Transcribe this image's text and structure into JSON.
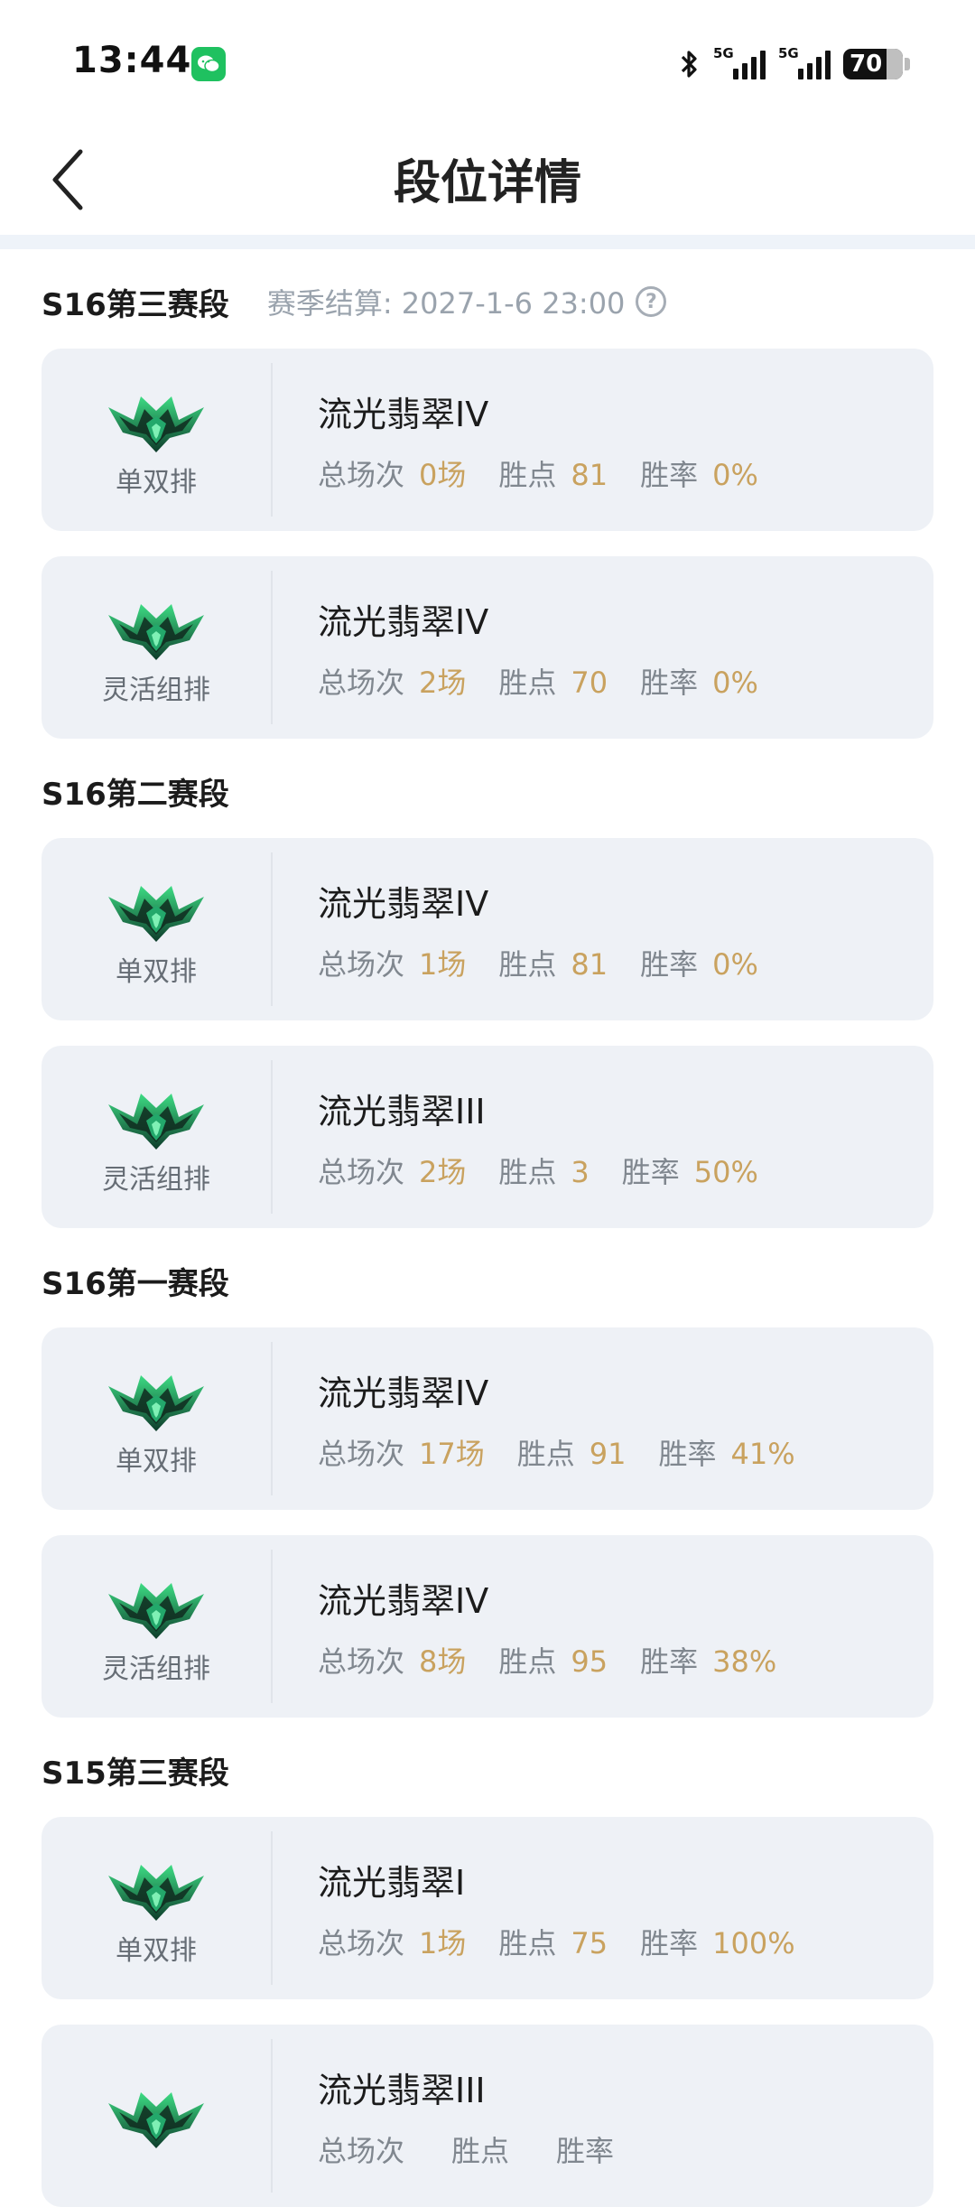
{
  "status_bar": {
    "time": "13:44",
    "signal_1_label": "5G",
    "signal_2_label": "5G",
    "battery": "70"
  },
  "header": {
    "title": "段位详情"
  },
  "labels": {
    "games": "总场次",
    "points": "胜点",
    "winrate": "胜率"
  },
  "sections": [
    {
      "title": "S16第三赛段",
      "settlement": "赛季结算: 2027-1-6 23:00",
      "cards": [
        {
          "queue": "单双排",
          "rank": "流光翡翠IV",
          "games": "0场",
          "points": "81",
          "winrate": "0%"
        },
        {
          "queue": "灵活组排",
          "rank": "流光翡翠IV",
          "games": "2场",
          "points": "70",
          "winrate": "0%"
        }
      ]
    },
    {
      "title": "S16第二赛段",
      "cards": [
        {
          "queue": "单双排",
          "rank": "流光翡翠IV",
          "games": "1场",
          "points": "81",
          "winrate": "0%"
        },
        {
          "queue": "灵活组排",
          "rank": "流光翡翠III",
          "games": "2场",
          "points": "3",
          "winrate": "50%"
        }
      ]
    },
    {
      "title": "S16第一赛段",
      "cards": [
        {
          "queue": "单双排",
          "rank": "流光翡翠IV",
          "games": "17场",
          "points": "91",
          "winrate": "41%"
        },
        {
          "queue": "灵活组排",
          "rank": "流光翡翠IV",
          "games": "8场",
          "points": "95",
          "winrate": "38%"
        }
      ]
    },
    {
      "title": "S15第三赛段",
      "cards": [
        {
          "queue": "单双排",
          "rank": "流光翡翠I",
          "games": "1场",
          "points": "75",
          "winrate": "100%"
        },
        {
          "queue": "",
          "rank": "流光翡翠III",
          "games": "",
          "points": "",
          "winrate": ""
        }
      ]
    }
  ]
}
